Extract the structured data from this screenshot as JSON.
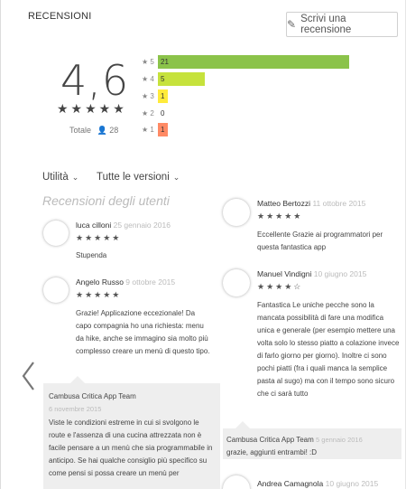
{
  "header": {
    "section_title": "RECENSIONI",
    "write_review_label": "Scrivi una recensione",
    "write_icon": "pencil-icon"
  },
  "summary": {
    "average": "4,6",
    "stars": "★★★★★",
    "total_label": "Totale",
    "total_icon": "person-icon",
    "total_count": "28",
    "rows": [
      {
        "label": "★ 5",
        "count": "21",
        "fraction": 0.78,
        "color": "#8bc34a"
      },
      {
        "label": "★ 4",
        "count": "5",
        "fraction": 0.19,
        "color": "#c6e23c"
      },
      {
        "label": "★ 3",
        "count": "1",
        "fraction": 0.04,
        "color": "#ffeb3b"
      },
      {
        "label": "★ 2",
        "count": "0",
        "fraction": 0.0,
        "color": "#ffb74d"
      },
      {
        "label": "★ 1",
        "count": "1",
        "fraction": 0.04,
        "color": "#ff8a65"
      }
    ]
  },
  "filters": {
    "sort_label": "Utilità",
    "version_label": "Tutte le versioni"
  },
  "reviews_heading": "Recensioni degli utenti",
  "reviews": {
    "r1": {
      "name": "luca cilloni",
      "date": "25 gennaio 2016",
      "stars": "★★★★★",
      "text": "Stupenda"
    },
    "r2": {
      "name": "Angelo Russo",
      "date": "9 ottobre 2015",
      "stars": "★★★★★",
      "text": "Grazie! Applicazione eccezionale! Da capo compagnia ho una richiesta: menu da hike, anche se immagino sia molto più complesso creare un menù di questo tipo."
    },
    "r2_reply": {
      "name": "Cambusa Critica App Team",
      "date": "6 novembre 2015",
      "text": "Viste le condizioni estreme in cui si svolgono le route e l'assenza di una cucina attrezzata non è facile pensare a un menù che sia programmabile in anticipo. Se hai qualche consiglio più specifico su come pensi si possa creare un menù per"
    },
    "r3": {
      "name": "Matteo Bertozzi",
      "date": "11 ottobre 2015",
      "stars": "★★★★★",
      "text": "Eccellente Grazie ai programmatori per questa fantastica app"
    },
    "r4": {
      "name": "Manuel Vindigni",
      "date": "10 giugno 2015",
      "stars": "★★★★☆",
      "text": "Fantastica Le uniche pecche sono la mancata possibilità di fare una modifica unica e generale (per esempio mettere una volta solo lo stesso piatto a colazione invece di farlo giorno per giorno). Inoltre ci sono pochi piatti (fra i quali manca la semplice pasta al sugo) ma con il tempo sono sicuro che ci sarà tutto"
    },
    "r4_reply": {
      "name": "Cambusa Critica App Team",
      "date": "5 gennaio 2016",
      "text": "grazie, aggiunti entrambi! :D"
    },
    "r5": {
      "name": "Andrea Camagnola",
      "date": "10 giugno 2015"
    }
  },
  "nav": {
    "prev_icon": "chevron-left-icon"
  }
}
